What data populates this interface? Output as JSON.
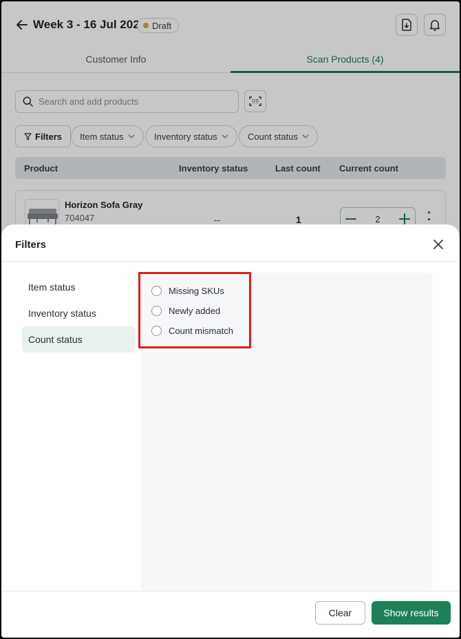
{
  "header": {
    "title": "Week 3 - 16 Jul 2026",
    "badge": "Draft",
    "badge_color": "#d9a43a",
    "icons": [
      "arrow-left-icon",
      "file-download-icon",
      "bell-icon"
    ]
  },
  "tabs": [
    {
      "label": "Customer Info",
      "active": false
    },
    {
      "label": "Scan Products (4)",
      "active": true
    }
  ],
  "search": {
    "placeholder": "Search and add products"
  },
  "filter_chips": [
    {
      "label": "Filters"
    },
    {
      "label": "Item status"
    },
    {
      "label": "Inventory status"
    },
    {
      "label": "Count status"
    }
  ],
  "table": {
    "columns": [
      "Product",
      "Inventory status",
      "Last count",
      "Current count"
    ],
    "rows": [
      {
        "name": "Horizon Sofa Gray",
        "sku": "704047",
        "inventory_status": "--",
        "last_count": "1",
        "current_count": "2"
      }
    ]
  },
  "sheet": {
    "title": "Filters",
    "categories": [
      {
        "label": "Item status",
        "active": false
      },
      {
        "label": "Inventory status",
        "active": false
      },
      {
        "label": "Count status",
        "active": true
      }
    ],
    "options": [
      {
        "label": "Missing SKUs",
        "selected": false
      },
      {
        "label": "Newly added",
        "selected": false
      },
      {
        "label": "Count mismatch",
        "selected": false
      }
    ],
    "clear_label": "Clear",
    "show_label": "Show results"
  },
  "colors": {
    "accent": "#1d7a55",
    "primary_button": "#1d8059",
    "highlight": "#e21b1b"
  }
}
